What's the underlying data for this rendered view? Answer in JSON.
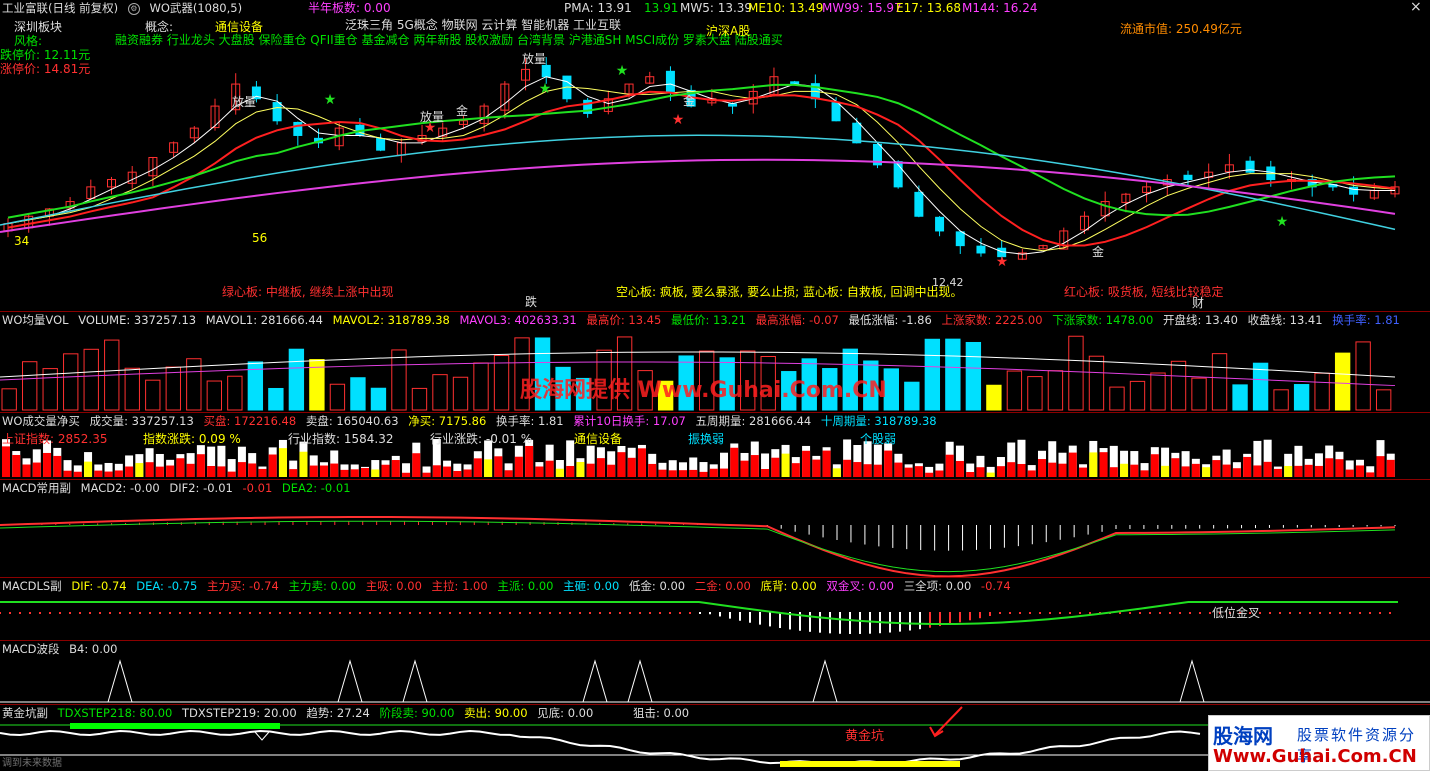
{
  "colors": {
    "up": "#ff3030",
    "down": "#00e0ff",
    "ma_red": "#ff2020",
    "ma_cyan": "#40d0e0",
    "ma_magenta": "#e040e0",
    "ma_green": "#20e020",
    "ma_yellow": "#ffff60"
  },
  "main": {
    "title_stock": "工业富联(日线 前复权)",
    "title_indicator": "WO武器(1080,5)",
    "half_year_boards": "半年板数: 0.00",
    "pma": "PMA: 13.91",
    "v13_91": "13.91",
    "mw5": "MW5: 13.39",
    "me10": "ME10: 13.49",
    "mw99": "MW99: 15.97",
    "e17": "E17: 13.68",
    "m144": "M144: 16.24",
    "board": "深圳板块",
    "concept_label": "概念:",
    "concept1": "通信设备",
    "style_label": "风格:",
    "tags_line1": "泛珠三角 5G概念 物联网 云计算 智能机器 工业互联",
    "tags_line2": "融资融券 行业龙头 大盘股 保险重仓 QFII重仓 基金减仓 两年新股 股权激励 台湾背景 沪港通SH MSCI成份 罗素大盘 陆股通买",
    "hushen": "沪深A股",
    "down_stop": "跌停价: 12.11元",
    "up_stop": "涨停价: 14.81元",
    "market_cap": "流通市值: 250.49亿元",
    "num34": "34",
    "num56": "56",
    "fangliang1": "放量",
    "fangliang2": "放量",
    "fangliang3": "放量",
    "jin1": "金",
    "jin2": "金",
    "jin3": "金",
    "price_low_label": "12.42",
    "green_board": "绿心板: 中继板, 继续上涨中出现",
    "die": "跌",
    "empty_board": "空心板: 疯板, 要么暴涨, 要么止损; 蓝心板: 自救板, 回调中出现。",
    "red_board": "红心板: 吸货板, 短线比较稳定",
    "cai": "财"
  },
  "vol": {
    "title": "WO均量VOL",
    "volume": "VOLUME: 337257.13",
    "mavol1": "MAVOL1: 281666.44",
    "mavol2": "MAVOL2: 318789.38",
    "mavol3": "MAVOL3: 402633.31",
    "high": "最高价: 13.45",
    "low": "最低价: 13.21",
    "max_amp": "最高涨幅: -0.07",
    "min_amp": "最低涨幅: -1.86",
    "up_count": "上涨家数: 2225.00",
    "down_count": "下涨家数: 1478.00",
    "open_line": "开盘线: 13.40",
    "close_line": "收盘线: 13.41",
    "turnover": "换手率: 1.81",
    "watermark": "股海网提供 Www.Guhai.Com.CN"
  },
  "netbuy": {
    "title": "WO成交量净买",
    "deal": "成交量: 337257.13",
    "buy": "买盘: 172216.48",
    "sell": "卖盘: 165040.63",
    "net": "净买: 7175.86",
    "turn": "换手率: 1.81",
    "turn10": "累计10日换手: 17.07",
    "wk5": "五周期量: 281666.44",
    "wk10": "十周期量: 318789.38",
    "sh_index": "上证指数: 2852.35",
    "index_chg": "指数涨跌: 0.09 %",
    "ind_index": "行业指数: 1584.32",
    "ind_chg": "行业涨跌: -0.01 %",
    "ind_name": "通信设备",
    "weak": "振换弱",
    "stock_weak": "个股弱"
  },
  "macd": {
    "title": "MACD常用副",
    "macd2": "MACD2: -0.00",
    "dif2": "DIF2: -0.01",
    "v": "-0.01",
    "dea2": "DEA2: -0.01"
  },
  "macdls": {
    "title": "MACDLS副",
    "dif": "DIF: -0.74",
    "dea": "DEA: -0.75",
    "main_buy": "主力买: -0.74",
    "main_sell": "主力卖: 0.00",
    "zx": "主吸: 0.00",
    "zl": "主拉: 1.00",
    "zp": "主派: 0.00",
    "zz": "主砸: 0.00",
    "dj": "低金: 0.00",
    "ej": "二金: 0.00",
    "db": "底背: 0.00",
    "sjc": "双金叉: 0.00",
    "sqx": "三全项: 0.00",
    "tail": "-0.74",
    "low_gold": "低位金叉"
  },
  "wave": {
    "title": "MACD波段",
    "b4": "B4: 0.00"
  },
  "gold": {
    "title": "黄金坑副",
    "s218": "TDXSTEP218: 80.00",
    "s219": "TDXSTEP219: 20.00",
    "trend": "趋势: 27.24",
    "stage_sell": "阶段卖: 90.00",
    "sell": "卖出: 90.00",
    "bottom": "见底: 0.00",
    "snipe": "狙击: 0.00",
    "pit": "黄金坑",
    "footer": "调到未来数据"
  },
  "logo": {
    "brand": "股海网",
    "slogan": "股票软件资源分享",
    "url": "Www.Guhai.Com.CN"
  },
  "chart_data": {
    "type": "candlestick",
    "close_series_estimate": [
      12.9,
      13.0,
      13.1,
      13.2,
      13.4,
      13.5,
      13.6,
      13.8,
      14.0,
      14.2,
      14.5,
      14.8,
      14.6,
      14.3,
      14.1,
      14.0,
      14.2,
      14.1,
      13.9,
      14.0,
      14.1,
      14.2,
      14.3,
      14.5,
      14.8,
      15.0,
      14.9,
      14.6,
      14.4,
      14.6,
      14.8,
      14.9,
      14.7,
      14.5,
      14.6,
      14.5,
      14.7,
      14.9,
      14.8,
      14.6,
      14.3,
      14.0,
      13.7,
      13.4,
      13.0,
      12.8,
      12.6,
      12.5,
      12.45,
      12.5,
      12.6,
      12.8,
      13.0,
      13.2,
      13.3,
      13.4,
      13.5,
      13.5,
      13.6,
      13.7,
      13.6,
      13.5,
      13.5,
      13.4,
      13.4,
      13.3,
      13.35,
      13.4
    ]
  }
}
